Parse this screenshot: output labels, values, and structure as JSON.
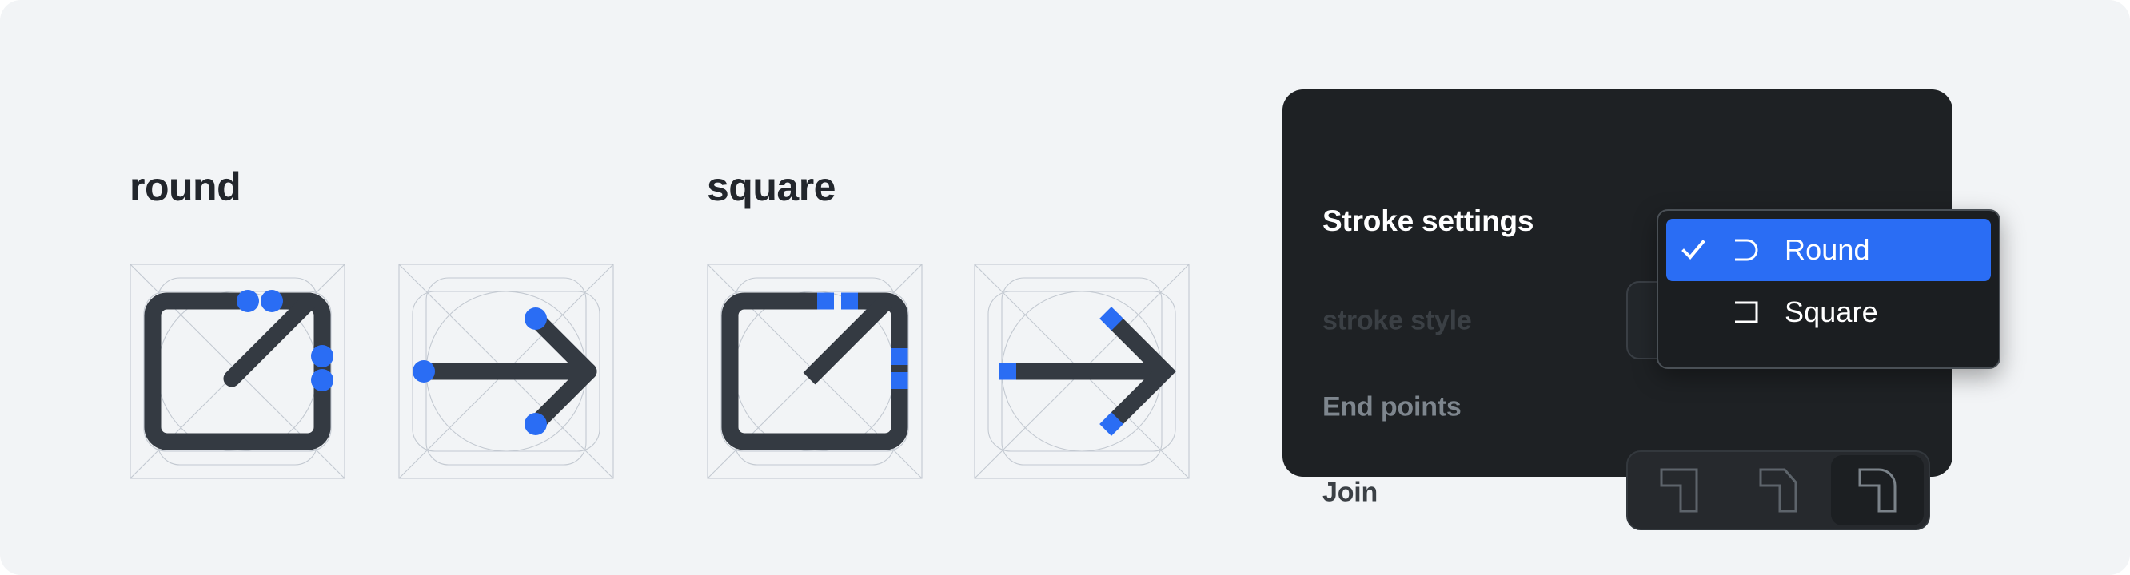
{
  "canvas": {
    "background_color": "#f2f4f6"
  },
  "demo": {
    "groups": [
      {
        "label": "round",
        "icons": [
          "external-link-icon",
          "arrow-right-icon"
        ]
      },
      {
        "label": "square",
        "icons": [
          "external-link-icon",
          "arrow-right-icon"
        ]
      }
    ],
    "stroke_color": "#343a42",
    "endpoint_marker_color": "#2a6df4",
    "guide_color": "#c3c9d1"
  },
  "panel": {
    "title": "Stroke settings",
    "background_color": "#1e2124",
    "rows": [
      {
        "label": "stroke style",
        "state": "dimmed"
      },
      {
        "label": "End points",
        "state": "active"
      },
      {
        "label": "Join",
        "state": "dimmed"
      }
    ],
    "join_options": [
      {
        "name": "miter-join-icon",
        "selected": false
      },
      {
        "name": "bevel-join-icon",
        "selected": false
      },
      {
        "name": "round-join-icon",
        "selected": true
      }
    ]
  },
  "dropdown": {
    "accent_color": "#2a6df4",
    "items": [
      {
        "label": "Round",
        "icon": "round-cap-icon",
        "selected": true,
        "check": "checkmark-icon"
      },
      {
        "label": "Square",
        "icon": "square-cap-icon",
        "selected": false,
        "check": ""
      }
    ]
  }
}
